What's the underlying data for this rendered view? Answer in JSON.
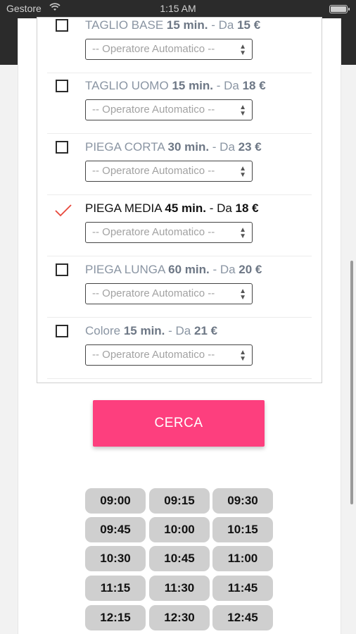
{
  "status_bar": {
    "carrier": "Gestore",
    "wifi_icon": "wifi-icon",
    "time": "1:15 AM",
    "battery_icon": "battery-icon"
  },
  "services": [
    {
      "name": "TAGLIO BASE",
      "duration": "15 min.",
      "sep": " - Da ",
      "price": "15 €",
      "checked": false,
      "operator": "-- Operatore Automatico --"
    },
    {
      "name": "TAGLIO UOMO",
      "duration": "15 min.",
      "sep": " - Da ",
      "price": "18 €",
      "checked": false,
      "operator": "-- Operatore Automatico --"
    },
    {
      "name": "PIEGA CORTA",
      "duration": "30 min.",
      "sep": " - Da ",
      "price": "23 €",
      "checked": false,
      "operator": "-- Operatore Automatico --"
    },
    {
      "name": "PIEGA MEDIA",
      "duration": "45 min.",
      "sep": " - Da ",
      "price": "18 €",
      "checked": true,
      "operator": "-- Operatore Automatico --"
    },
    {
      "name": "PIEGA LUNGA",
      "duration": "60 min.",
      "sep": " - Da ",
      "price": "20 €",
      "checked": false,
      "operator": "-- Operatore Automatico --"
    },
    {
      "name": "Colore",
      "duration": "15 min.",
      "sep": " - Da ",
      "price": "21 €",
      "checked": false,
      "operator": "-- Operatore Automatico --"
    }
  ],
  "search_button": "CERCA",
  "time_slots": [
    "09:00",
    "09:15",
    "09:30",
    "09:45",
    "10:00",
    "10:15",
    "10:30",
    "10:45",
    "11:00",
    "11:15",
    "11:30",
    "11:45",
    "12:15",
    "12:30",
    "12:45"
  ],
  "colors": {
    "accent": "#fd3f7e",
    "check": "#e8473a",
    "slot_bg": "#cfcfcf",
    "header_bg": "#2b2b2b"
  }
}
